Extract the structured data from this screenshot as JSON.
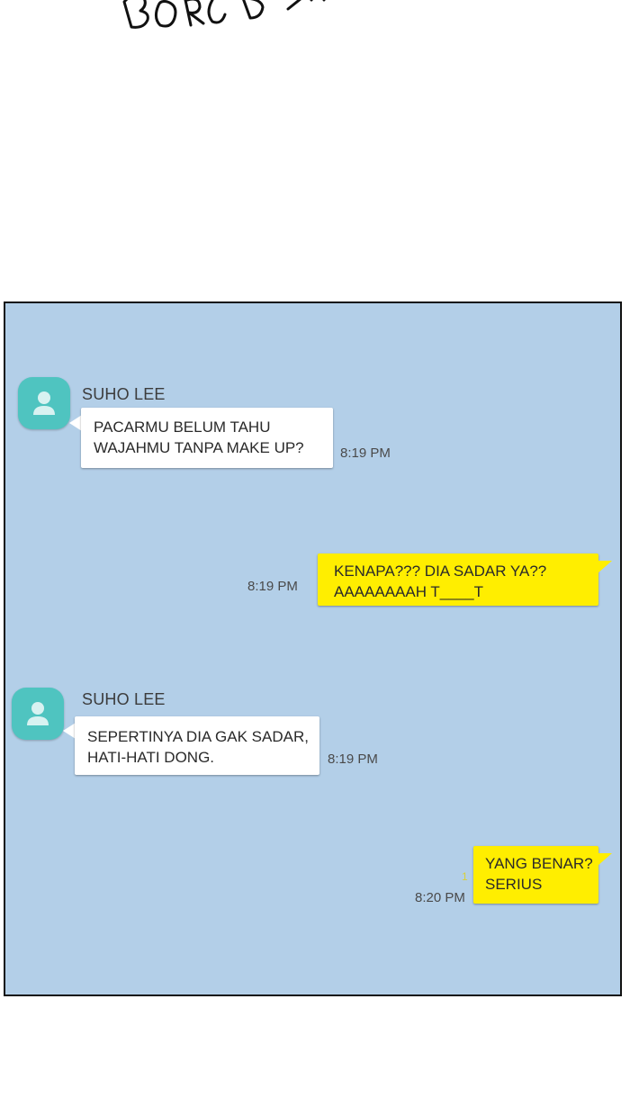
{
  "chat": {
    "messages": [
      {
        "sender": "SUHO LEE",
        "lines": [
          "PACARMU BELUM TAHU",
          "WAJAHMU TANPA MAKE UP?"
        ],
        "time": "8:19 PM"
      },
      {
        "lines": [
          "KENAPA??? DIA SADAR YA??",
          "AAAAAAAAH T____T"
        ],
        "time": "8:19 PM"
      },
      {
        "sender": "SUHO LEE",
        "lines": [
          "SEPERTINYA DIA GAK SADAR,",
          "HATI-HATI DONG."
        ],
        "time": "8:19 PM"
      },
      {
        "lines": [
          "YANG BENAR?",
          "SERIUS"
        ],
        "time": "8:20 PM",
        "unread": "1"
      }
    ]
  },
  "colors": {
    "panel_bg": "#b3cfe8",
    "incoming_bubble": "#ffffff",
    "outgoing_bubble": "#ffee00",
    "avatar": "#4fc4c0"
  },
  "icons": {
    "avatar": "person-icon"
  }
}
